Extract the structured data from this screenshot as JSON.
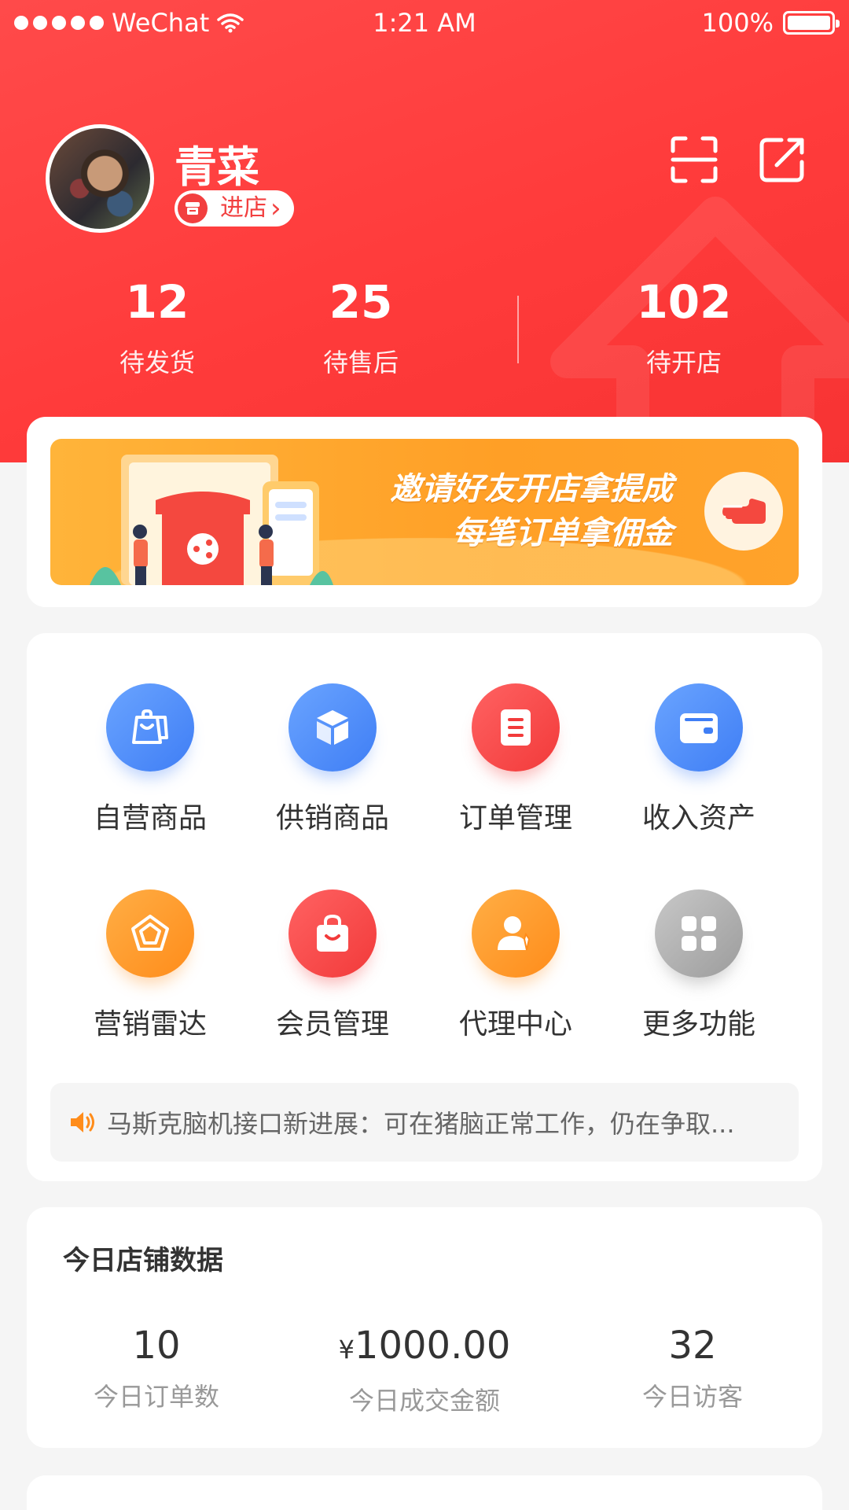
{
  "status_bar": {
    "carrier": "WeChat",
    "time": "1:21 AM",
    "battery": "100%"
  },
  "profile": {
    "name": "青菜",
    "enter_shop_label": "进店",
    "enter_shop_arrow": "›"
  },
  "stats": [
    {
      "value": "12",
      "label": "待发货"
    },
    {
      "value": "25",
      "label": "待售后"
    },
    {
      "value": "102",
      "label": "待开店"
    }
  ],
  "banner": {
    "line1": "邀请好友开店拿提成",
    "line2": "每笔订单拿佣金"
  },
  "menu": [
    {
      "label": "自营商品",
      "icon": "shopping-bag-icon",
      "color": "blue"
    },
    {
      "label": "供销商品",
      "icon": "cube-icon",
      "color": "blue"
    },
    {
      "label": "订单管理",
      "icon": "document-icon",
      "color": "red"
    },
    {
      "label": "收入资产",
      "icon": "wallet-icon",
      "color": "blue"
    },
    {
      "label": "营销雷达",
      "icon": "pentagon-radar-icon",
      "color": "orange"
    },
    {
      "label": "会员管理",
      "icon": "bag-smile-icon",
      "color": "red"
    },
    {
      "label": "代理中心",
      "icon": "person-tie-icon",
      "color": "orange"
    },
    {
      "label": "更多功能",
      "icon": "grid-icon",
      "color": "gray"
    }
  ],
  "notice": {
    "text": "马斯克脑机接口新进展：可在猪脑正常工作，仍在争取..."
  },
  "today_data": {
    "title": "今日店铺数据",
    "items": [
      {
        "value": "10",
        "prefix": "",
        "label": "今日订单数"
      },
      {
        "value": "1000.00",
        "prefix": "¥",
        "label": "今日成交金额"
      },
      {
        "value": "32",
        "prefix": "",
        "label": "今日访客"
      }
    ]
  },
  "colors": {
    "header_red": "#ff4040",
    "accent_blue": "#4a86f7",
    "accent_orange": "#ff9a26",
    "accent_red": "#f23f3f"
  }
}
